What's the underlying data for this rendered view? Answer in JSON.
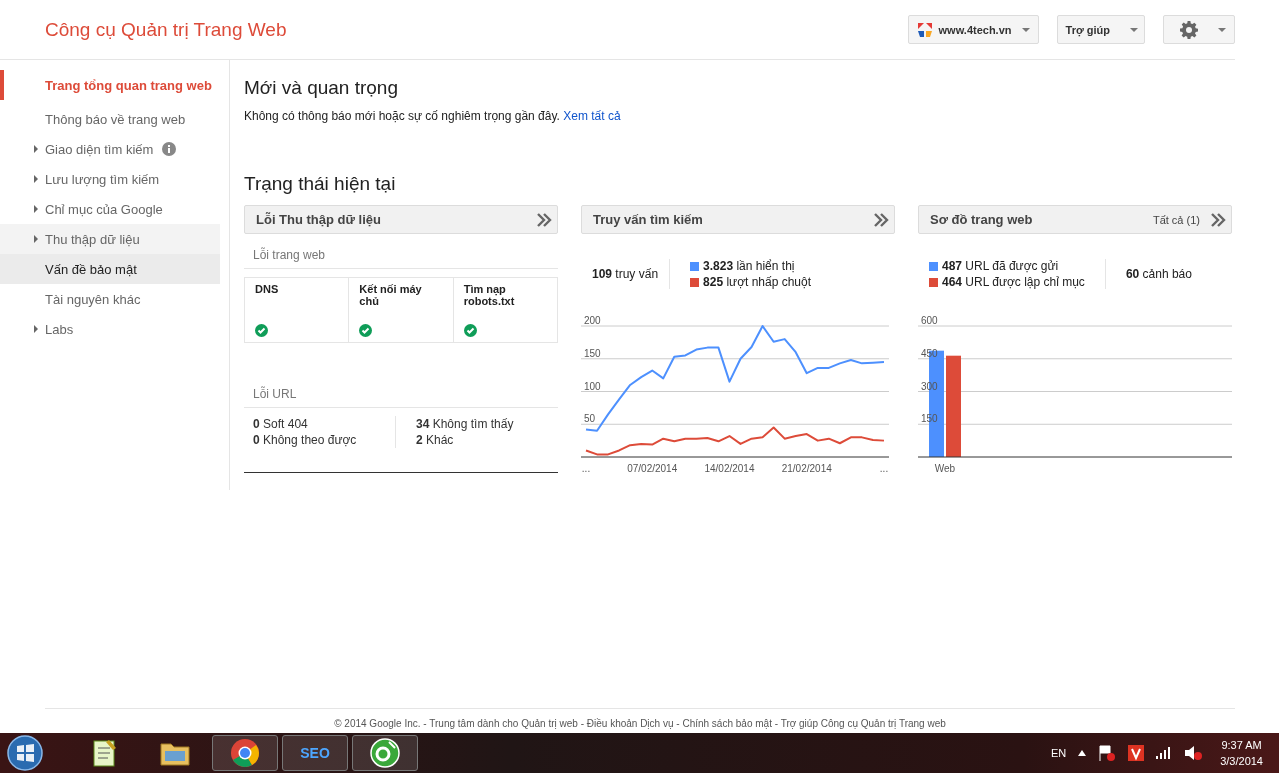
{
  "header": {
    "title": "Công cụ Quản trị Trang Web",
    "site_selector": "www.4tech.vn",
    "help_button": "Trợ giúp"
  },
  "sidebar": {
    "items": [
      {
        "label": "Trang tổng quan trang web",
        "selected": true,
        "expandable": false,
        "info": false,
        "shaded": false,
        "hovered": false
      },
      {
        "label": "Thông báo về trang web",
        "selected": false,
        "expandable": false,
        "info": false,
        "shaded": false,
        "hovered": false
      },
      {
        "label": "Giao diện tìm kiếm",
        "selected": false,
        "expandable": true,
        "info": true,
        "shaded": false,
        "hovered": false
      },
      {
        "label": "Lưu lượng tìm kiếm",
        "selected": false,
        "expandable": true,
        "info": false,
        "shaded": false,
        "hovered": false
      },
      {
        "label": "Chỉ mục của Google",
        "selected": false,
        "expandable": true,
        "info": false,
        "shaded": false,
        "hovered": false
      },
      {
        "label": "Thu thập dữ liệu",
        "selected": false,
        "expandable": true,
        "info": false,
        "shaded": true,
        "hovered": false
      },
      {
        "label": "Vấn đề bảo mật",
        "selected": false,
        "expandable": false,
        "info": false,
        "shaded": false,
        "hovered": true
      },
      {
        "label": "Tài nguyên khác",
        "selected": false,
        "expandable": false,
        "info": false,
        "shaded": false,
        "hovered": false
      },
      {
        "label": "Labs",
        "selected": false,
        "expandable": true,
        "info": false,
        "shaded": false,
        "hovered": false
      }
    ]
  },
  "news": {
    "title": "Mới và quan trọng",
    "message": "Không có thông báo mới hoặc sự cố nghiêm trọng gần đây.",
    "link": "Xem tất cả"
  },
  "status": {
    "title": "Trạng thái hiện tại",
    "crawl_errors": {
      "title": "Lỗi Thu thập dữ liệu",
      "site_errors_label": "Lỗi trang web",
      "site_errors": [
        {
          "label": "DNS",
          "ok": true
        },
        {
          "label": "Kết nối máy chủ",
          "ok": true
        },
        {
          "label": "Tìm nạp robots.txt",
          "ok": true
        }
      ],
      "url_errors_label": "Lỗi URL",
      "url_errors": [
        [
          "**0** Soft 404",
          "**0** Không theo được"
        ],
        [
          "**34** Không tìm thấy",
          "**2** Khác"
        ]
      ]
    },
    "search_queries": {
      "title": "Truy vấn tìm kiếm",
      "total": "**109** truy vấn",
      "legend": [
        {
          "text": "**3.823** lần hiển thị",
          "color": "#4d90fe"
        },
        {
          "text": "**825** lượt nhấp chuột",
          "color": "#dd4b39"
        }
      ],
      "chart_data": {
        "type": "line",
        "grid": true,
        "ylim": [
          0,
          200
        ],
        "yticks": [
          50,
          100,
          150,
          200
        ],
        "categories": [
          "...",
          null,
          null,
          null,
          null,
          null,
          "07/02/2014",
          null,
          null,
          null,
          null,
          null,
          null,
          "14/02/2014",
          null,
          null,
          null,
          null,
          null,
          null,
          "21/02/2014",
          null,
          null,
          null,
          null,
          null,
          null,
          "..."
        ],
        "series": [
          {
            "color": "#4d90fe",
            "values": [
              42,
              40,
              65,
              88,
              110,
              122,
              132,
              120,
              153,
              155,
              164,
              167,
              167,
              115,
              150,
              168,
              200,
              176,
              180,
              160,
              128,
              136,
              136,
              143,
              148,
              143,
              144,
              145
            ]
          },
          {
            "color": "#dd4b39",
            "values": [
              10,
              4,
              4,
              10,
              18,
              20,
              19,
              28,
              24,
              28,
              28,
              29,
              24,
              32,
              20,
              28,
              30,
              45,
              28,
              32,
              35,
              25,
              28,
              21,
              30,
              30,
              26,
              25
            ]
          }
        ]
      }
    },
    "sitemaps": {
      "title": "Sơ đồ trang web",
      "all_link": "Tất cả (1)",
      "legend": [
        {
          "text": "**487** URL đã được gửi",
          "color": "#4d90fe"
        },
        {
          "text": "**464** URL được lập chỉ mục",
          "color": "#dd4b39"
        }
      ],
      "warnings": "**60** cảnh báo",
      "chart_data": {
        "type": "bar",
        "grid": true,
        "categories": [
          "Web"
        ],
        "ylim": [
          0,
          600
        ],
        "yticks": [
          150,
          300,
          450,
          600
        ],
        "series": [
          {
            "color": "#4d90fe",
            "values": [
              487
            ]
          },
          {
            "color": "#dd4b39",
            "values": [
              464
            ]
          }
        ]
      }
    }
  },
  "footer": {
    "copyright": "© 2014 Google Inc.",
    "separator": "-",
    "links": [
      "Trung tâm dành cho Quản trị web",
      "Điều khoản Dịch vụ",
      "Chính sách bảo mật",
      "Trợ giúp Công cụ Quản trị Trang web"
    ]
  },
  "taskbar": {
    "apps": [
      {
        "kind": "notepad",
        "running": false
      },
      {
        "kind": "folder",
        "running": false
      },
      {
        "kind": "chrome",
        "running": true
      },
      {
        "kind": "seo",
        "label": "SEO",
        "running": true
      },
      {
        "kind": "green",
        "running": true
      }
    ],
    "language": "EN",
    "time": "9:37 AM",
    "date": "3/3/2014"
  }
}
